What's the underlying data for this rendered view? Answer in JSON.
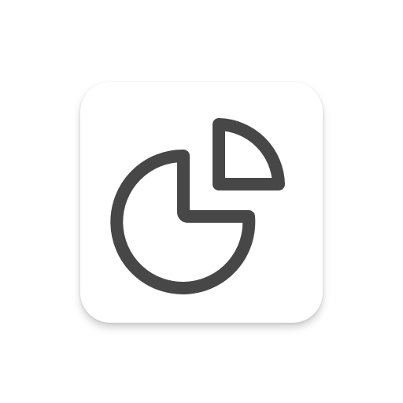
{
  "app_icon": {
    "icon_name": "pie-chart-icon",
    "background_color": "#ffffff",
    "stroke_color": "#474747"
  }
}
